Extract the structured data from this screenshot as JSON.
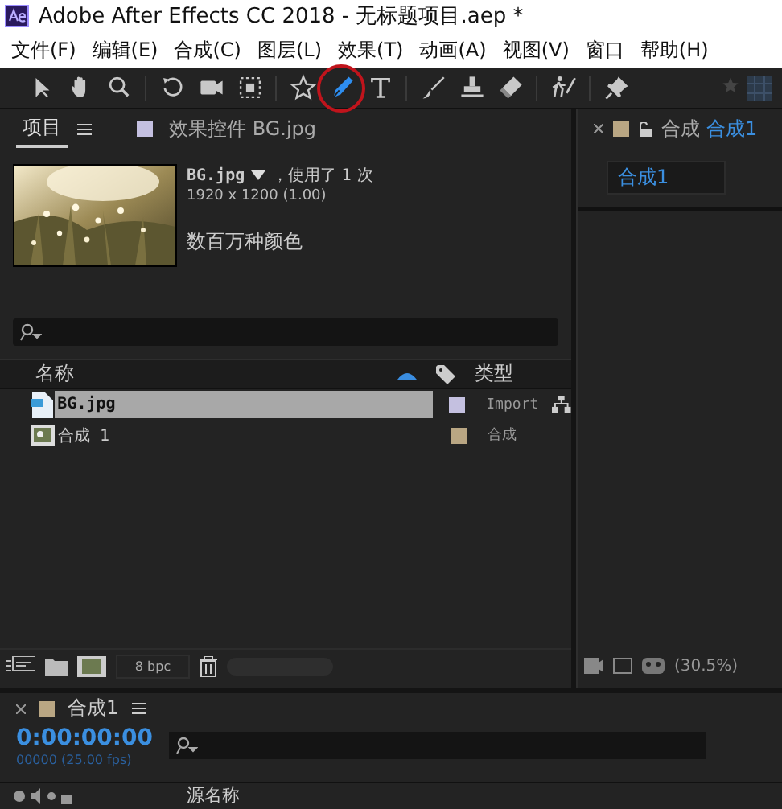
{
  "window": {
    "title": "Adobe After Effects CC 2018 - 无标题项目.aep *"
  },
  "menu": [
    "文件(F)",
    "编辑(E)",
    "合成(C)",
    "图层(L)",
    "效果(T)",
    "动画(A)",
    "视图(V)",
    "窗口",
    "帮助(H)"
  ],
  "toolbar": [
    {
      "kind": "select",
      "selected": false,
      "highlighted": false
    },
    {
      "kind": "hand",
      "selected": false,
      "highlighted": false
    },
    {
      "kind": "zoom",
      "selected": false,
      "highlighted": false
    },
    {
      "kind": "rotate",
      "selected": false,
      "highlighted": false
    },
    {
      "kind": "camera",
      "selected": false,
      "highlighted": false
    },
    {
      "kind": "pan",
      "selected": false,
      "highlighted": false
    },
    {
      "kind": "star",
      "selected": false,
      "highlighted": false
    },
    {
      "kind": "pen",
      "selected": true,
      "highlighted": true
    },
    {
      "kind": "text",
      "selected": false,
      "highlighted": false
    },
    {
      "kind": "brush",
      "selected": false,
      "highlighted": false
    },
    {
      "kind": "stamp",
      "selected": false,
      "highlighted": false
    },
    {
      "kind": "eraser",
      "selected": false,
      "highlighted": false
    },
    {
      "kind": "puppet",
      "selected": false,
      "highlighted": false
    },
    {
      "kind": "pin",
      "selected": false,
      "highlighted": false
    }
  ],
  "project_panel": {
    "tabs": [
      {
        "label": "项目",
        "selected": true
      },
      {
        "label": "效果控件 BG.jpg",
        "selected": false,
        "color": "#c4c0e0"
      }
    ],
    "preview": {
      "name": "BG.jpg",
      "usage": "，使用了 1 次",
      "dimensions": "1920 x 1200 (1.00)",
      "colors": "数百万种颜色"
    },
    "columns": [
      "名称",
      "类型"
    ],
    "rows": [
      {
        "kind": "footage",
        "name": "BG.jpg",
        "color": "#c4c0e0",
        "type": "Import",
        "selected": true
      },
      {
        "kind": "comp",
        "name": "合成 1",
        "color": "#b9a683",
        "type": "合成",
        "selected": false
      }
    ],
    "bit_depth": "8 bpc"
  },
  "comp_panel": {
    "tab_prefix": "合成",
    "tab_name": "合成1",
    "color": "#b9a683",
    "breadcrumb": "合成1",
    "zoom": "(30.5%)"
  },
  "timeline": {
    "tab": "合成1",
    "color": "#b9a683",
    "timecode": "0:00:00:00",
    "frames": "00000 (25.00 fps)",
    "column": "源名称"
  }
}
